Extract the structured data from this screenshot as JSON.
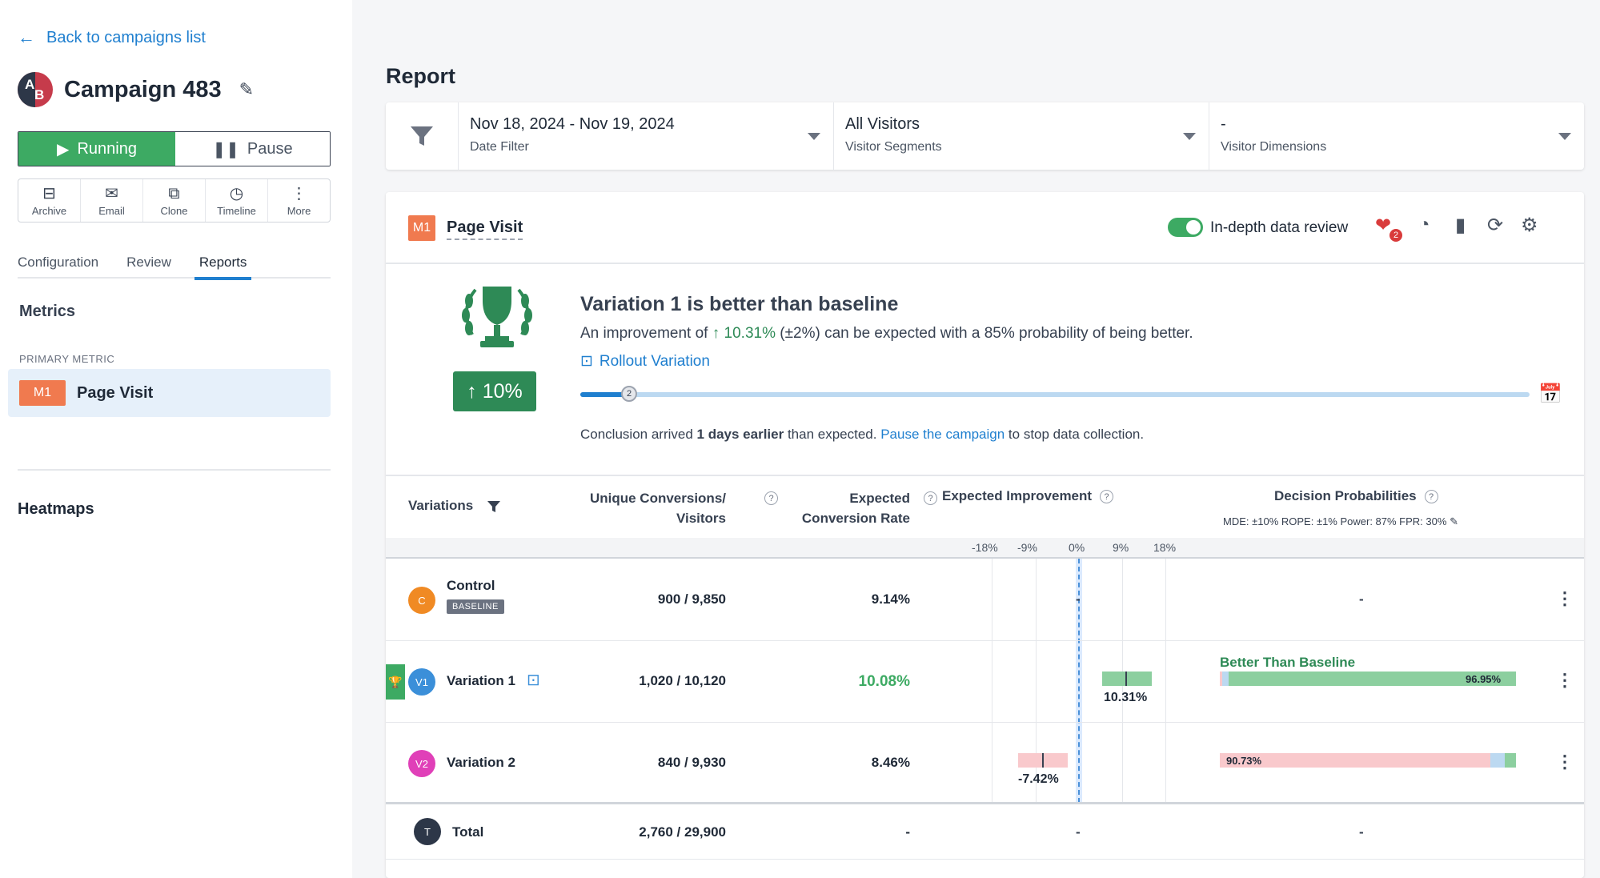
{
  "sidebar": {
    "back_link": "Back to campaigns list",
    "campaign_title": "Campaign 483",
    "logo_letters": [
      "A",
      "B"
    ],
    "run_label": "Running",
    "pause_label": "Pause",
    "actions": [
      {
        "label": "Archive",
        "icon": "archive-icon"
      },
      {
        "label": "Email",
        "icon": "email-icon"
      },
      {
        "label": "Clone",
        "icon": "clone-icon"
      },
      {
        "label": "Timeline",
        "icon": "timeline-icon"
      },
      {
        "label": "More",
        "icon": "more-icon"
      }
    ],
    "tabs": [
      "Configuration",
      "Review",
      "Reports"
    ],
    "active_tab": "Reports",
    "metrics_heading": "Metrics",
    "primary_metric_label": "PRIMARY METRIC",
    "metric_badge": "M1",
    "metric_name": "Page Visit",
    "heatmaps_heading": "Heatmaps"
  },
  "report": {
    "title": "Report",
    "filters": [
      {
        "value": "Nov 18, 2024 - Nov 19, 2024",
        "label": "Date Filter"
      },
      {
        "value": "All Visitors",
        "label": "Visitor Segments"
      },
      {
        "value": "-",
        "label": "Visitor Dimensions"
      }
    ]
  },
  "card": {
    "badge": "M1",
    "title": "Page Visit",
    "toggle_label": "In-depth data review",
    "toggle_on": true,
    "heart_count": "2",
    "summary": {
      "headline": "Variation 1 is better than baseline",
      "text_prefix": "An improvement of ",
      "improvement": "10.31%",
      "text_suffix": " (±2%) can be expected with a 85% probability of being better.",
      "rollout": "Rollout Variation",
      "badge": "10%",
      "slider_value": "2",
      "slider_fraction": 0.05,
      "conclusion_prefix": "Conclusion arrived ",
      "conclusion_bold": "1 days earlier",
      "conclusion_mid": " than expected. ",
      "conclusion_link": "Pause the campaign",
      "conclusion_suffix": " to stop data collection."
    },
    "table": {
      "headers": {
        "variations": "Variations",
        "conversions_1": "Unique Conversions/",
        "conversions_2": "Visitors",
        "rate_1": "Expected",
        "rate_2": "Conversion Rate",
        "improvement": "Expected Improvement",
        "probabilities": "Decision Probabilities",
        "probabilities_sub": "MDE: ±10%  ROPE: ±1%  Power: 87%  FPR: 30%"
      },
      "axis_ticks": [
        "-18%",
        "-9%",
        "0%",
        "9%",
        "18%"
      ],
      "rows": [
        {
          "badge": "C",
          "name": "Control",
          "baseline": "BASELINE",
          "color": "#f08a24",
          "conversions": "900 / 9,850",
          "rate": "9.14%",
          "improvement": "-",
          "probability": "-"
        },
        {
          "badge": "V1",
          "name": "Variation 1",
          "color": "#3b8fd9",
          "conversions": "1,020 / 10,120",
          "rate": "10.08%",
          "rate_color": "#3daa63",
          "improvement": "10.31%",
          "improvement_value": 10.31,
          "probability_title": "Better Than Baseline",
          "probability": "96.95%"
        },
        {
          "badge": "V2",
          "name": "Variation 2",
          "color": "#e040b8",
          "conversions": "840 / 9,930",
          "rate": "8.46%",
          "improvement": "-7.42%",
          "improvement_value": -7.42,
          "probability": "90.73%"
        }
      ],
      "total": {
        "badge": "T",
        "name": "Total",
        "conversions": "2,760 / 29,900",
        "rate": "-",
        "improvement": "-",
        "probability": "-"
      }
    }
  },
  "colors": {
    "accent": "#1f7fcf",
    "success": "#3daa63",
    "success_dark": "#2e8a56",
    "metric_badge": "#f07a4f",
    "danger_bar": "#f9c9cc"
  }
}
